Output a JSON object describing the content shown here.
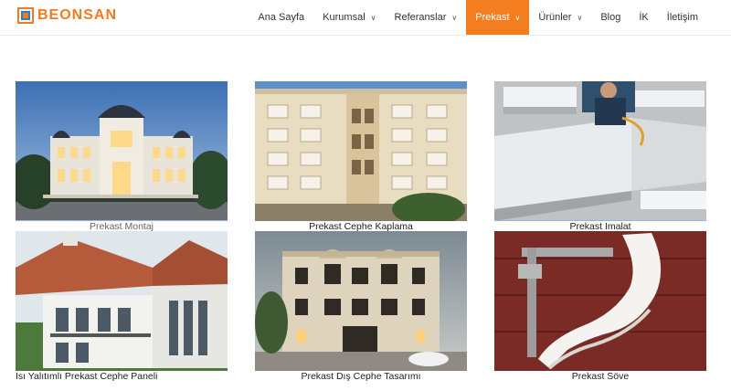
{
  "brand": {
    "name": "BEONSAN",
    "accent": "#f47d20",
    "logo_icon": "beonsan-logo-icon"
  },
  "nav": {
    "items": [
      {
        "label": "Ana Sayfa",
        "dropdown": false,
        "active": false
      },
      {
        "label": "Kurumsal",
        "dropdown": true,
        "active": false
      },
      {
        "label": "Referanslar",
        "dropdown": true,
        "active": false
      },
      {
        "label": "Prekast",
        "dropdown": true,
        "active": true
      },
      {
        "label": "Ürünler",
        "dropdown": true,
        "active": false
      },
      {
        "label": "Blog",
        "dropdown": false,
        "active": false
      },
      {
        "label": "İK",
        "dropdown": false,
        "active": false
      },
      {
        "label": "İletişim",
        "dropdown": false,
        "active": false
      }
    ]
  },
  "gallery": {
    "items": [
      {
        "caption": "Prekast Montaj",
        "image": "palace-building-night"
      },
      {
        "caption": "Prekast Cephe Kaplama",
        "image": "apartment-facade"
      },
      {
        "caption": "Prekast Imalat",
        "image": "precast-production-workshop"
      },
      {
        "caption": "Isı Yalıtımlı Prekast Cephe Paneli",
        "image": "villa-roof"
      },
      {
        "caption": "Prekast Dış Cephe Tasarımı",
        "image": "classic-facade-render"
      },
      {
        "caption": "Prekast Söve",
        "image": "cornice-mould-profile"
      }
    ]
  }
}
